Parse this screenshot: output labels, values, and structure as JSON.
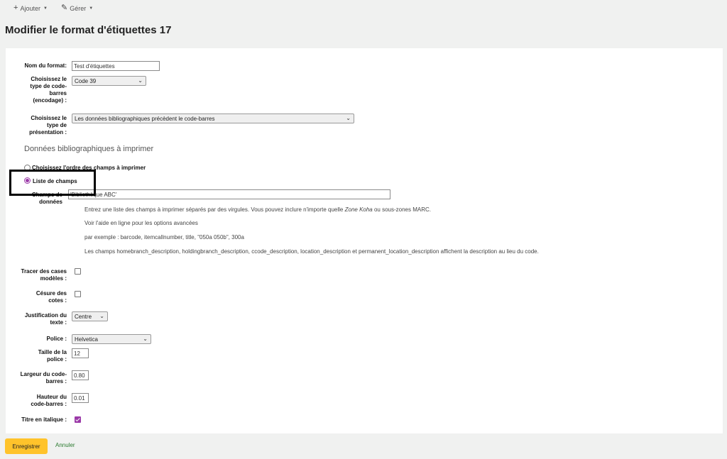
{
  "toolbar": {
    "add_label": "Ajouter",
    "manage_label": "Gérer"
  },
  "page_title": "Modifier le format d'étiquettes 17",
  "form": {
    "format_name": {
      "label": "Nom du format:",
      "value": "Test d'étiquettes"
    },
    "barcode_type": {
      "label_lines": [
        "Choisissez le",
        "type de code-",
        "barres",
        "(encodage) :"
      ],
      "value": "Code 39"
    },
    "layout_type": {
      "label_lines": [
        "Choisissez le",
        "type de",
        "présentation :"
      ],
      "value": "Les données bibliographiques précèdent le code-barres"
    },
    "biblio_section_title": "Données bibliographiques à imprimer",
    "radio_order": {
      "label": "Choisissez l'ordre des champs à imprimer",
      "checked": false
    },
    "radio_list": {
      "label": "Liste de champs",
      "checked": true
    },
    "data_fields": {
      "label_lines": [
        "Champs de",
        "données"
      ],
      "value": "'Bibliothèque ABC'",
      "hint1_pre": "Entrez une liste des champs à imprimer séparés par des virgules. Vous pouvez inclure n'importe quelle ",
      "hint1_em": "Zone Koha",
      "hint1_post": " ou sous-zones MARC.",
      "hint2": "Voir l'aide en ligne pour les options avancées",
      "hint3": "par exemple : barcode, itemcallnumber, title, \"050a 050b\", 300a",
      "hint4": "Les champs homebranch_description, holdingbranch_description, ccode_description, location_description et permanent_location_description affichent la description au lieu du code."
    },
    "guide_boxes": {
      "label_lines": [
        "Tracer des cases",
        "modèles :"
      ],
      "checked": false
    },
    "callnum_split": {
      "label_lines": [
        "Césure des",
        "cotes :"
      ],
      "checked": false
    },
    "text_justify": {
      "label_lines": [
        "Justification du",
        "texte :"
      ],
      "value": "Centre"
    },
    "font": {
      "label": "Police :",
      "value": "Helvetica"
    },
    "font_size": {
      "label_lines": [
        "Taille de la",
        "police :"
      ],
      "value": "12"
    },
    "barcode_width": {
      "label_lines": [
        "Largeur du code-",
        "barres :"
      ],
      "value": "0.80"
    },
    "barcode_height": {
      "label_lines": [
        "Hauteur du",
        "code-barres :"
      ],
      "value": "0.01"
    },
    "italic_title": {
      "label": "Titre en italique :",
      "checked": true
    }
  },
  "actions": {
    "save_label": "Enregistrer",
    "cancel_label": "Annuler"
  },
  "colors": {
    "accent": "#9b3aa8",
    "save_button": "#ffc32b",
    "cancel_link": "#2a7a2e",
    "background": "#f0f1f0"
  }
}
